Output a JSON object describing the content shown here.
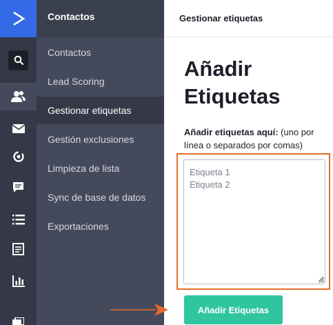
{
  "sidebar_icons": [
    {
      "name": "search-icon",
      "active": false
    },
    {
      "name": "contacts-icon",
      "active": true
    },
    {
      "name": "mail-icon",
      "active": false
    },
    {
      "name": "automation-icon",
      "active": false
    },
    {
      "name": "conversations-icon",
      "active": false
    },
    {
      "name": "lists-icon",
      "active": false
    },
    {
      "name": "forms-icon",
      "active": false
    },
    {
      "name": "reports-icon",
      "active": false
    },
    {
      "name": "pages-icon",
      "active": false
    }
  ],
  "subnav": {
    "title": "Contactos",
    "items": [
      {
        "label": "Contactos"
      },
      {
        "label": "Lead Scoring"
      },
      {
        "label": "Gestionar etiquetas"
      },
      {
        "label": "Gestión exclusiones"
      },
      {
        "label": "Limpieza de lista"
      },
      {
        "label": "Sync de base de datos"
      },
      {
        "label": "Exportaciones"
      }
    ],
    "active_item": "Gestionar etiquetas"
  },
  "main": {
    "breadcrumb": "Gestionar etiquetas",
    "heading": "Añadir Etiquetas",
    "label_bold": "Añadir etiquetas aquí:",
    "label_hint": "(uno por línea o separados por comas)",
    "textarea_placeholder": "Etiqueta 1\nEtiqueta 2",
    "textarea_value": "",
    "submit_label": "Añadir Etiquetas"
  },
  "colors": {
    "brand_blue": "#356ae6",
    "rail_bg": "#353947",
    "subnav_bg": "#444a5b",
    "button_green": "#2fc59e",
    "highlight_orange": "#e46d2a"
  }
}
